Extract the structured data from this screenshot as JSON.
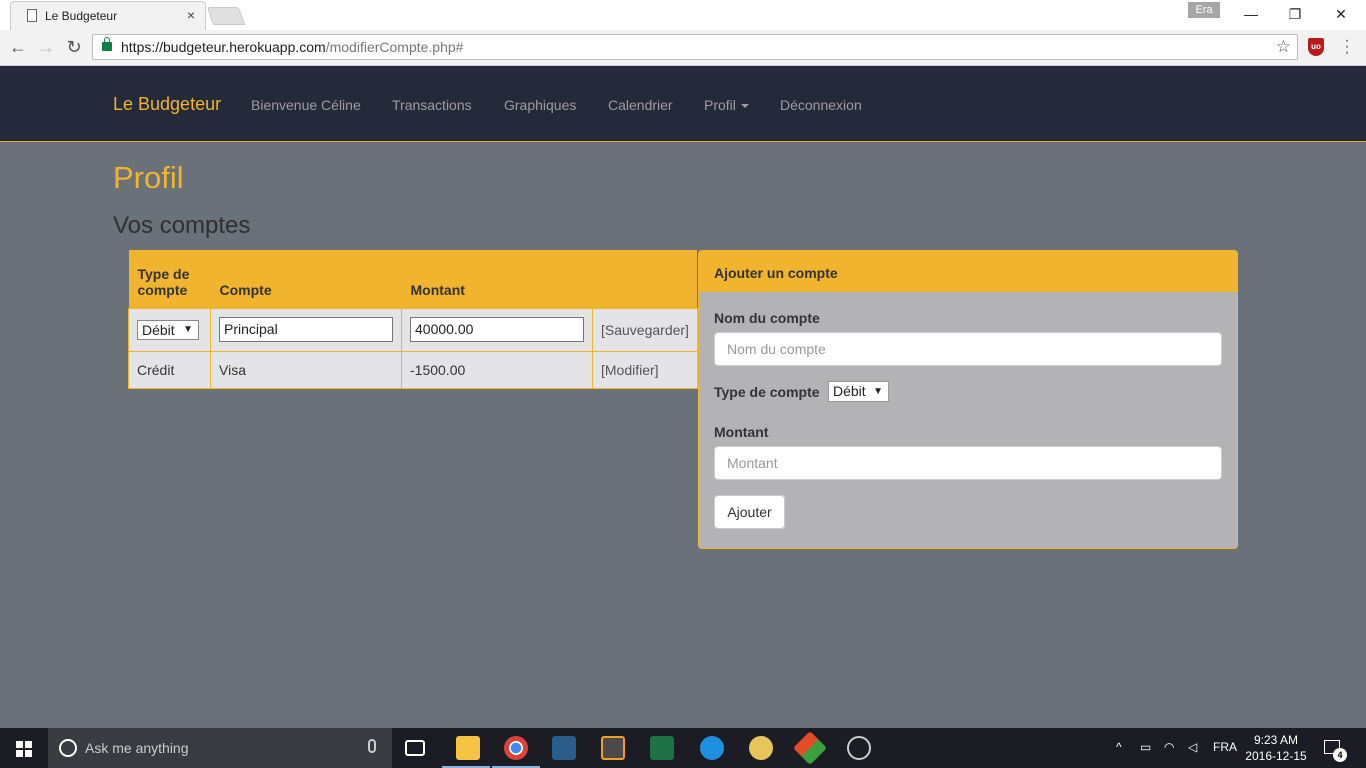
{
  "browser": {
    "tab_title": "Le Budgeteur",
    "tab_close": "×",
    "url_base": "https://budgeteur.herokuapp.com",
    "url_path": "/modifierCompte.php#",
    "user_badge": "Era",
    "minimize": "—",
    "restore": "❐",
    "close": "✕",
    "extension_label": "uo"
  },
  "navbar": {
    "brand": "Le Budgeteur",
    "links": [
      "Bienvenue Céline",
      "Transactions",
      "Graphiques",
      "Calendrier",
      "Profil",
      "Déconnexion"
    ]
  },
  "page": {
    "title": "Profil",
    "subtitle": "Vos comptes"
  },
  "accounts_table": {
    "headers": [
      "Type de compte",
      "Compte",
      "Montant",
      ""
    ],
    "rows": [
      {
        "type": "Débit",
        "name": "Principal",
        "amount": "40000.00",
        "action": "[Sauvegarder]",
        "editing": true
      },
      {
        "type": "Crédit",
        "name": "Visa",
        "amount": "-1500.00",
        "action": "[Modifier]",
        "editing": false
      }
    ]
  },
  "add_panel": {
    "heading": "Ajouter un compte",
    "name_label": "Nom du compte",
    "name_placeholder": "Nom du compte",
    "type_label": "Type de compte",
    "type_value": "Débit",
    "amount_label": "Montant",
    "amount_placeholder": "Montant",
    "submit": "Ajouter"
  },
  "taskbar": {
    "search_text": "Ask me anything",
    "language": "FRA",
    "time": "9:23 AM",
    "date": "2016-12-15",
    "notifications": "4"
  },
  "colors": {
    "accent": "#f0b42e",
    "navbar_bg": "#252a3a",
    "page_bg": "#6b7179",
    "panel_bg": "#b3b3b6"
  }
}
